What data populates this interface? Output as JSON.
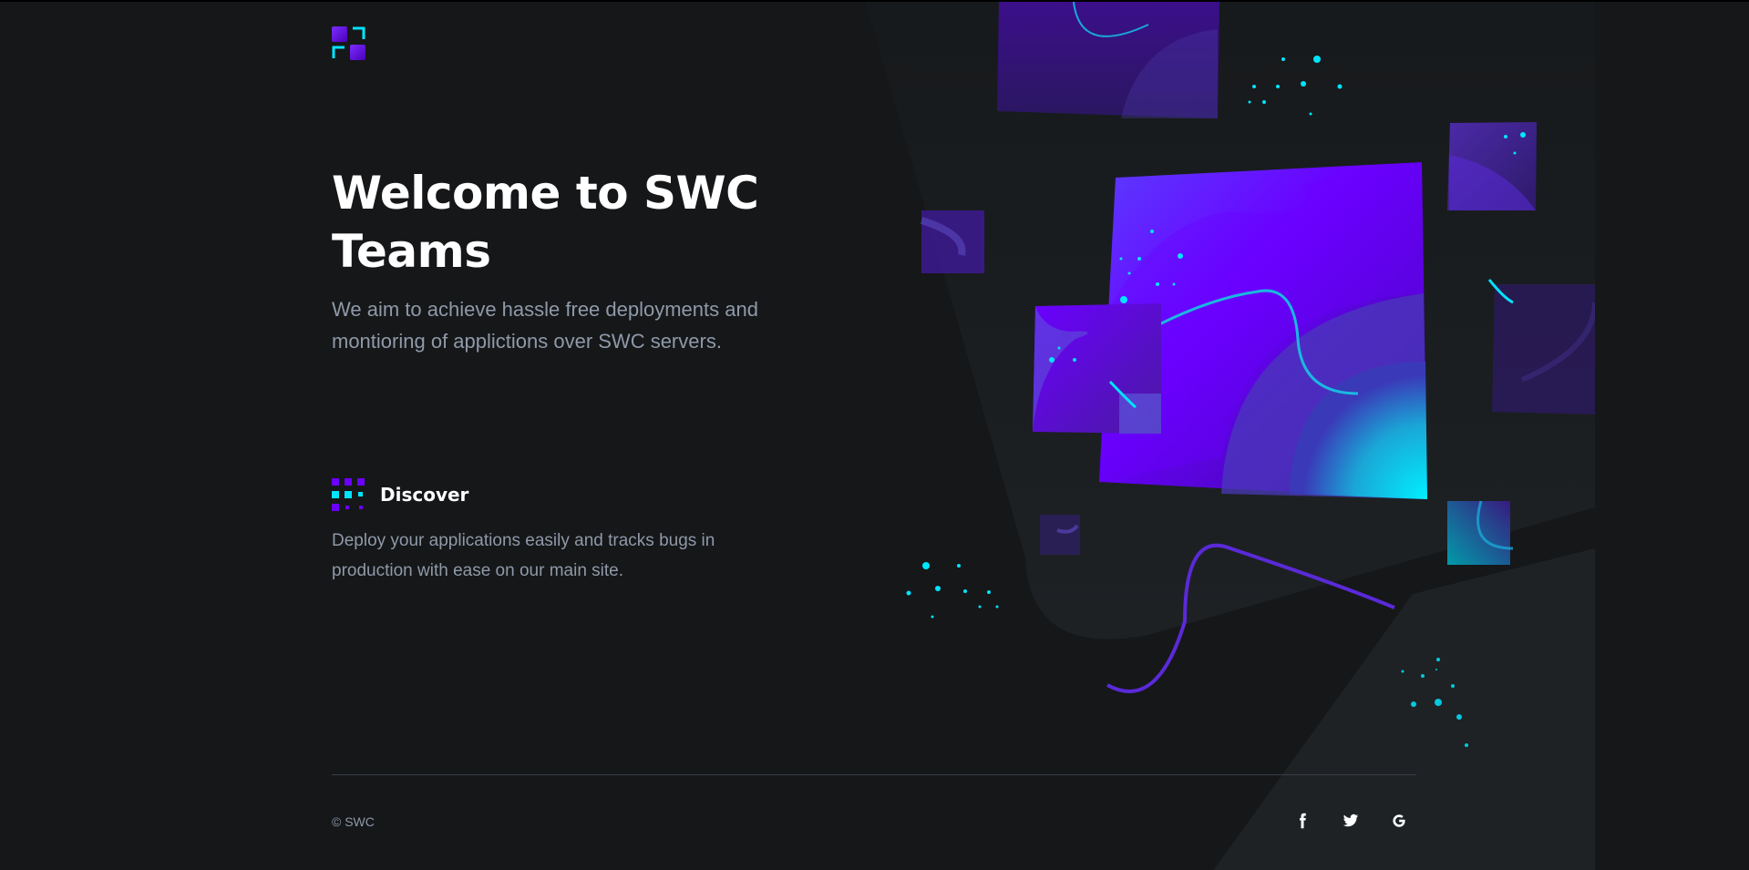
{
  "hero": {
    "title": "Welcome to SWC Teams",
    "subtitle": "We aim to achieve hassle free deployments and montioring of applictions over SWC servers."
  },
  "feature": {
    "icon": "grid-dots-icon",
    "title": "Discover",
    "text": "Deploy your applications easily and tracks bugs in production with ease on our main site."
  },
  "footer": {
    "copyright": "© SWC",
    "social": [
      {
        "name": "facebook-icon"
      },
      {
        "name": "twitter-icon"
      },
      {
        "name": "google-icon"
      }
    ]
  },
  "colors": {
    "background": "#151719",
    "accent_purple": "#6a00ff",
    "accent_cyan": "#00e5ff",
    "muted_text": "#8f99a8"
  }
}
